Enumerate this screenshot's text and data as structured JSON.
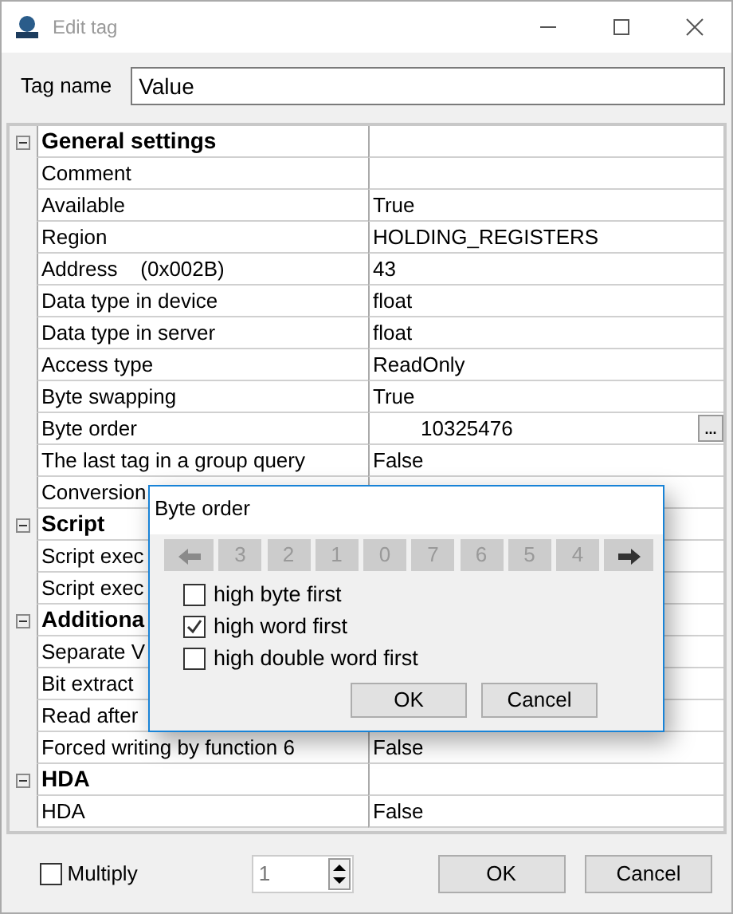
{
  "window": {
    "title": "Edit tag"
  },
  "tag_name": {
    "label": "Tag name",
    "value": "Value"
  },
  "sections": [
    {
      "title": "General settings",
      "expanded": true,
      "rows": [
        {
          "label": "Comment",
          "value": ""
        },
        {
          "label": "Available",
          "value": "True"
        },
        {
          "label": "Region",
          "value": "HOLDING_REGISTERS"
        },
        {
          "label": "Address    (0x002B)",
          "value": "43"
        },
        {
          "label": "Data type in device",
          "value": "float"
        },
        {
          "label": "Data type in server",
          "value": "float"
        },
        {
          "label": "Access type",
          "value": "ReadOnly"
        },
        {
          "label": "Byte swapping",
          "value": "True"
        },
        {
          "label": "Byte order",
          "value": "10325476",
          "button": "..."
        },
        {
          "label": "The last tag in a group query",
          "value": "False"
        },
        {
          "label": "Conversion",
          "value": ""
        }
      ]
    },
    {
      "title": "Script",
      "expanded": true,
      "rows": [
        {
          "label": "Script exec",
          "value": ""
        },
        {
          "label": "Script exec",
          "value": ""
        }
      ]
    },
    {
      "title": "Additiona",
      "expanded": true,
      "rows": [
        {
          "label": "Separate V",
          "value": ""
        },
        {
          "label": "Bit extract",
          "value": ""
        },
        {
          "label": "Read after",
          "value": ""
        },
        {
          "label": "Forced writing by function 6",
          "value": "False"
        }
      ]
    },
    {
      "title": "HDA",
      "expanded": true,
      "rows": [
        {
          "label": "HDA",
          "value": "False"
        }
      ]
    }
  ],
  "popup": {
    "title": "Byte order",
    "order_buttons": [
      {
        "kind": "arrow-left",
        "disabled": true
      },
      {
        "kind": "digit",
        "label": "3",
        "disabled": true
      },
      {
        "kind": "digit",
        "label": "2",
        "disabled": true
      },
      {
        "kind": "digit",
        "label": "1",
        "disabled": true
      },
      {
        "kind": "digit",
        "label": "0",
        "disabled": true
      },
      {
        "kind": "digit",
        "label": "7",
        "disabled": true
      },
      {
        "kind": "digit",
        "label": "6",
        "disabled": true
      },
      {
        "kind": "digit",
        "label": "5",
        "disabled": true
      },
      {
        "kind": "digit",
        "label": "4",
        "disabled": true
      },
      {
        "kind": "arrow-right",
        "disabled": false
      }
    ],
    "options": [
      {
        "label": "high byte first",
        "checked": false
      },
      {
        "label": "high word first",
        "checked": true
      },
      {
        "label": "high double word first",
        "checked": false
      }
    ],
    "buttons": [
      "OK",
      "Cancel"
    ]
  },
  "footer": {
    "multiply": {
      "label": "Multiply",
      "checked": false
    },
    "count": "1",
    "buttons": [
      "OK",
      "Cancel"
    ]
  }
}
